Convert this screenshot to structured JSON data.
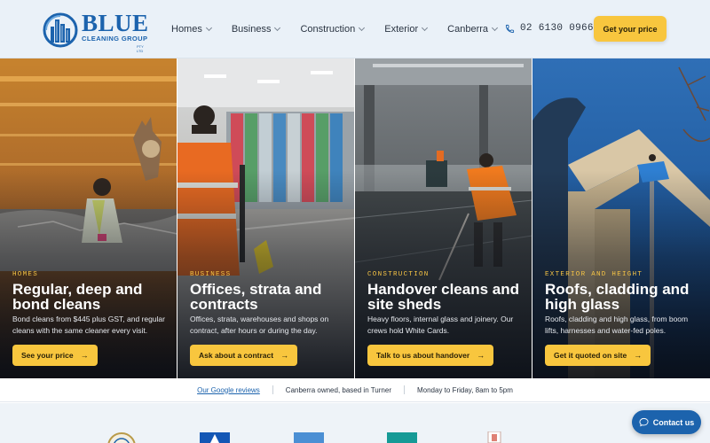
{
  "header": {
    "logo_word": "BLUE",
    "logo_sub": "CLEANING GROUP",
    "logo_ptl": "PTY LTD",
    "nav": [
      {
        "label": "Homes"
      },
      {
        "label": "Business"
      },
      {
        "label": "Construction"
      },
      {
        "label": "Exterior"
      },
      {
        "label": "Canberra"
      }
    ],
    "phone": "02 6130 0966",
    "cta": "Get your price"
  },
  "panels": [
    {
      "eyebrow": "HOMES",
      "title": "Regular, deep and bond cleans",
      "desc": "Bond cleans from $445 plus GST, and regular cleans with the same cleaner every visit.",
      "button": "See your price"
    },
    {
      "eyebrow": "BUSINESS",
      "title": "Offices, strata and contracts",
      "desc": "Offices, strata, warehouses and shops on contract, after hours or during the day.",
      "button": "Ask about a contract"
    },
    {
      "eyebrow": "CONSTRUCTION",
      "title": "Handover cleans and site sheds",
      "desc": "Heavy floors, internal glass and joinery. Our crews hold White Cards.",
      "button": "Talk to us about handover"
    },
    {
      "eyebrow": "EXTERIOR AND HEIGHT",
      "title": "Roofs, cladding and high glass",
      "desc": "Roofs, cladding and high glass, from boom lifts, harnesses and water-fed poles.",
      "button": "Get it quoted on site"
    }
  ],
  "strip": {
    "reviews_link": "Our Google reviews",
    "owned": "Canberra owned, based in Turner",
    "hours": "Monday to Friday, 8am to 5pm"
  },
  "chat": {
    "label": "Contact us"
  },
  "colors": {
    "brand_blue": "#1c63ad",
    "accent_yellow": "#f8c63e",
    "eyebrow_yellow": "#f6c445"
  }
}
